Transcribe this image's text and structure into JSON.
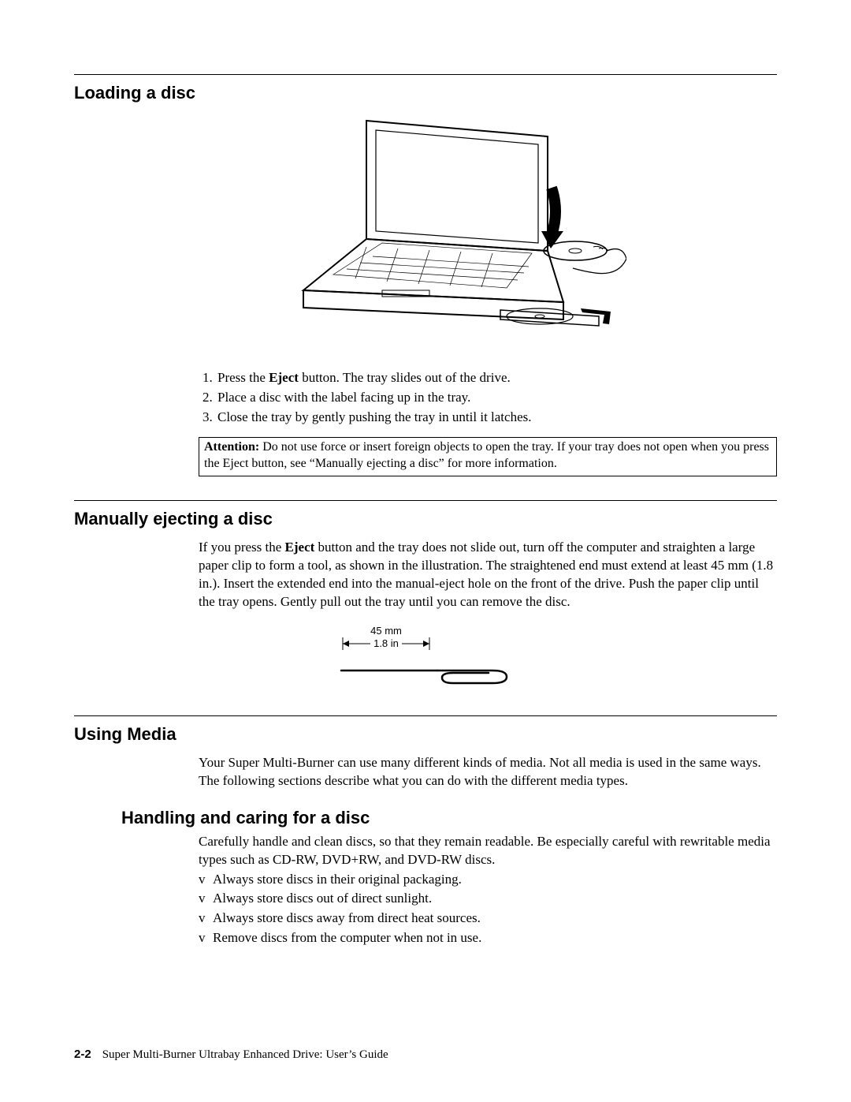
{
  "loading": {
    "title": "Loading a disc",
    "step1_prefix": "Press the ",
    "step1_bold": "Eject",
    "step1_suffix": " button. The tray slides out of the drive.",
    "step2": "Place a disc with the label facing up in the tray.",
    "step3": "Close the tray by gently pushing the tray in until it latches.",
    "attention_label": "Attention:",
    "attention_text": " Do not use force or insert foreign objects to open the tray. If your tray does not open when you press the Eject button, see “Manually ejecting a disc” for more information."
  },
  "manual_eject": {
    "title": "Manually ejecting a disc",
    "para_prefix": "If you press the ",
    "para_bold": "Eject",
    "para_suffix": " button and the tray does not slide out, turn off the computer and straighten a large paper clip to form a tool, as shown in the illustration. The straightened end must extend at least 45 mm (1.8 in.). Insert the extended end into the manual-eject hole on the front of the drive. Push the paper clip until the tray opens. Gently pull out the tray until you can remove the disc.",
    "measure_mm": "45 mm",
    "measure_in": "1.8 in"
  },
  "using_media": {
    "title": "Using Media",
    "para": "Your Super Multi-Burner can use many different kinds of media. Not all media is used in the same ways. The following sections describe what you can do with the different media types."
  },
  "handling": {
    "title": "Handling and caring for a disc",
    "para": "Carefully handle and clean discs, so that they remain readable. Be especially careful with rewritable media types such as CD-RW, DVD+RW, and DVD-RW discs.",
    "b1": "Always store discs in their original packaging.",
    "b2": "Always store discs out of direct sunlight.",
    "b3": "Always store discs away from direct heat sources.",
    "b4": "Remove discs from the computer when not in use."
  },
  "footer": {
    "pagenum": "2-2",
    "title": "Super Multi-Burner Ultrabay Enhanced Drive: User’s Guide"
  }
}
